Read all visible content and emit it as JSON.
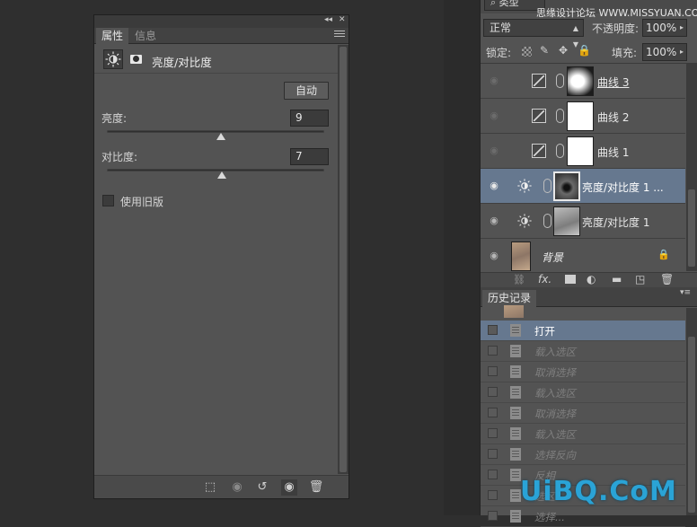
{
  "properties_panel": {
    "tabs": [
      {
        "label": "属性"
      },
      {
        "label": "信息"
      }
    ],
    "title": "亮度/对比度",
    "auto_button": "自动",
    "brightness": {
      "label": "亮度:",
      "value": "9",
      "slider": 0.54
    },
    "contrast": {
      "label": "对比度:",
      "value": "7",
      "slider": 0.53
    },
    "legacy_checkbox": {
      "label": "使用旧版",
      "checked": false
    }
  },
  "layers_panel": {
    "filter_kind": "类型",
    "watermark_top": "思缘设计论坛 WWW.MISSYUAN.COM",
    "blend_mode": "正常",
    "opacity_label": "不透明度:",
    "opacity_value": "100%",
    "lock_label": "锁定:",
    "fill_label": "填充:",
    "fill_value": "100%",
    "layers": [
      {
        "name": "曲线 3",
        "type": "curves",
        "visible": false,
        "mask": "gradient"
      },
      {
        "name": "曲线 2",
        "type": "curves",
        "visible": false,
        "mask": "white"
      },
      {
        "name": "曲线 1",
        "type": "curves",
        "visible": false,
        "mask": "white"
      },
      {
        "name": "亮度/对比度 1 ...",
        "type": "brightness",
        "visible": true,
        "mask": "dark",
        "selected": true
      },
      {
        "name": "亮度/对比度 1",
        "type": "brightness",
        "visible": true,
        "mask": "photo"
      },
      {
        "name": "背景",
        "type": "background",
        "visible": true,
        "locked": true
      }
    ]
  },
  "history_panel": {
    "tab_label": "历史记录",
    "items": [
      {
        "label": "打开",
        "active": true
      },
      {
        "label": "载入选区"
      },
      {
        "label": "取消选择"
      },
      {
        "label": "载入选区"
      },
      {
        "label": "取消选择"
      },
      {
        "label": "载入选区"
      },
      {
        "label": "选择反向"
      },
      {
        "label": "反相"
      },
      {
        "label": "选区..."
      },
      {
        "label": "选择..."
      }
    ]
  },
  "watermark_bottom": "UiBQ.CoM",
  "colors": {
    "panel": "#535353",
    "selection": "#66788f",
    "background": "#2f2f2f",
    "watermark": "#2aa3d6"
  }
}
